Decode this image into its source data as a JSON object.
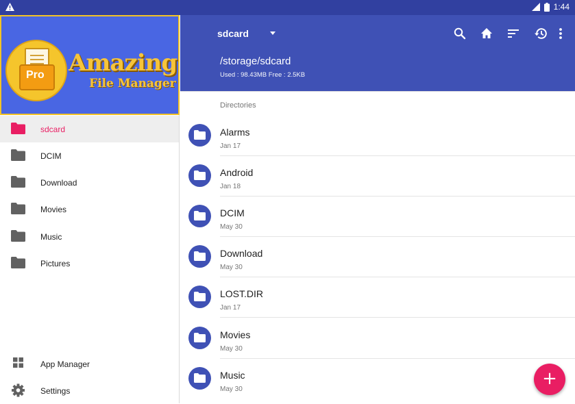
{
  "status_bar": {
    "time": "1:44"
  },
  "banner": {
    "logo_badge": "Pro",
    "title": "Amazing",
    "subtitle": "File Manager"
  },
  "drawer": {
    "items": [
      {
        "label": "sdcard",
        "icon": "folder-icon",
        "active": true
      },
      {
        "label": "DCIM",
        "icon": "folder-icon"
      },
      {
        "label": "Download",
        "icon": "folder-icon"
      },
      {
        "label": "Movies",
        "icon": "folder-icon"
      },
      {
        "label": "Music",
        "icon": "folder-icon"
      },
      {
        "label": "Pictures",
        "icon": "folder-icon"
      }
    ],
    "bottom_items": [
      {
        "label": "App Manager",
        "icon": "apps-grid-icon"
      },
      {
        "label": "Settings",
        "icon": "gear-icon"
      }
    ]
  },
  "toolbar": {
    "drive": "sdcard",
    "path": "/storage/sdcard",
    "usage": "Used : 98.43MB Free : 2.5KB",
    "actions": [
      "search-icon",
      "home-icon",
      "sort-icon",
      "history-icon",
      "more-vert-icon"
    ]
  },
  "content": {
    "section_label": "Directories",
    "directories": [
      {
        "name": "Alarms",
        "date": "Jan 17"
      },
      {
        "name": "Android",
        "date": "Jan 18"
      },
      {
        "name": "DCIM",
        "date": "May 30"
      },
      {
        "name": "Download",
        "date": "May 30"
      },
      {
        "name": "LOST.DIR",
        "date": "Jan 17"
      },
      {
        "name": "Movies",
        "date": "May 30"
      },
      {
        "name": "Music",
        "date": "May 30"
      }
    ]
  },
  "fab": {
    "symbol": "+"
  },
  "colors": {
    "primary": "#3f51b5",
    "status_bar": "#3140a0",
    "accent": "#e91e63"
  }
}
